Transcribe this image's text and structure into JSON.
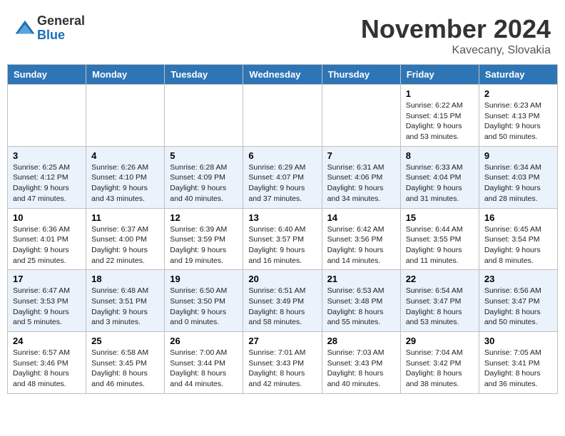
{
  "header": {
    "logo_line1": "General",
    "logo_line2": "Blue",
    "month_title": "November 2024",
    "subtitle": "Kavecany, Slovakia"
  },
  "weekdays": [
    "Sunday",
    "Monday",
    "Tuesday",
    "Wednesday",
    "Thursday",
    "Friday",
    "Saturday"
  ],
  "weeks": [
    [
      {
        "day": "",
        "info": ""
      },
      {
        "day": "",
        "info": ""
      },
      {
        "day": "",
        "info": ""
      },
      {
        "day": "",
        "info": ""
      },
      {
        "day": "",
        "info": ""
      },
      {
        "day": "1",
        "info": "Sunrise: 6:22 AM\nSunset: 4:15 PM\nDaylight: 9 hours and 53 minutes."
      },
      {
        "day": "2",
        "info": "Sunrise: 6:23 AM\nSunset: 4:13 PM\nDaylight: 9 hours and 50 minutes."
      }
    ],
    [
      {
        "day": "3",
        "info": "Sunrise: 6:25 AM\nSunset: 4:12 PM\nDaylight: 9 hours and 47 minutes."
      },
      {
        "day": "4",
        "info": "Sunrise: 6:26 AM\nSunset: 4:10 PM\nDaylight: 9 hours and 43 minutes."
      },
      {
        "day": "5",
        "info": "Sunrise: 6:28 AM\nSunset: 4:09 PM\nDaylight: 9 hours and 40 minutes."
      },
      {
        "day": "6",
        "info": "Sunrise: 6:29 AM\nSunset: 4:07 PM\nDaylight: 9 hours and 37 minutes."
      },
      {
        "day": "7",
        "info": "Sunrise: 6:31 AM\nSunset: 4:06 PM\nDaylight: 9 hours and 34 minutes."
      },
      {
        "day": "8",
        "info": "Sunrise: 6:33 AM\nSunset: 4:04 PM\nDaylight: 9 hours and 31 minutes."
      },
      {
        "day": "9",
        "info": "Sunrise: 6:34 AM\nSunset: 4:03 PM\nDaylight: 9 hours and 28 minutes."
      }
    ],
    [
      {
        "day": "10",
        "info": "Sunrise: 6:36 AM\nSunset: 4:01 PM\nDaylight: 9 hours and 25 minutes."
      },
      {
        "day": "11",
        "info": "Sunrise: 6:37 AM\nSunset: 4:00 PM\nDaylight: 9 hours and 22 minutes."
      },
      {
        "day": "12",
        "info": "Sunrise: 6:39 AM\nSunset: 3:59 PM\nDaylight: 9 hours and 19 minutes."
      },
      {
        "day": "13",
        "info": "Sunrise: 6:40 AM\nSunset: 3:57 PM\nDaylight: 9 hours and 16 minutes."
      },
      {
        "day": "14",
        "info": "Sunrise: 6:42 AM\nSunset: 3:56 PM\nDaylight: 9 hours and 14 minutes."
      },
      {
        "day": "15",
        "info": "Sunrise: 6:44 AM\nSunset: 3:55 PM\nDaylight: 9 hours and 11 minutes."
      },
      {
        "day": "16",
        "info": "Sunrise: 6:45 AM\nSunset: 3:54 PM\nDaylight: 9 hours and 8 minutes."
      }
    ],
    [
      {
        "day": "17",
        "info": "Sunrise: 6:47 AM\nSunset: 3:53 PM\nDaylight: 9 hours and 5 minutes."
      },
      {
        "day": "18",
        "info": "Sunrise: 6:48 AM\nSunset: 3:51 PM\nDaylight: 9 hours and 3 minutes."
      },
      {
        "day": "19",
        "info": "Sunrise: 6:50 AM\nSunset: 3:50 PM\nDaylight: 9 hours and 0 minutes."
      },
      {
        "day": "20",
        "info": "Sunrise: 6:51 AM\nSunset: 3:49 PM\nDaylight: 8 hours and 58 minutes."
      },
      {
        "day": "21",
        "info": "Sunrise: 6:53 AM\nSunset: 3:48 PM\nDaylight: 8 hours and 55 minutes."
      },
      {
        "day": "22",
        "info": "Sunrise: 6:54 AM\nSunset: 3:47 PM\nDaylight: 8 hours and 53 minutes."
      },
      {
        "day": "23",
        "info": "Sunrise: 6:56 AM\nSunset: 3:47 PM\nDaylight: 8 hours and 50 minutes."
      }
    ],
    [
      {
        "day": "24",
        "info": "Sunrise: 6:57 AM\nSunset: 3:46 PM\nDaylight: 8 hours and 48 minutes."
      },
      {
        "day": "25",
        "info": "Sunrise: 6:58 AM\nSunset: 3:45 PM\nDaylight: 8 hours and 46 minutes."
      },
      {
        "day": "26",
        "info": "Sunrise: 7:00 AM\nSunset: 3:44 PM\nDaylight: 8 hours and 44 minutes."
      },
      {
        "day": "27",
        "info": "Sunrise: 7:01 AM\nSunset: 3:43 PM\nDaylight: 8 hours and 42 minutes."
      },
      {
        "day": "28",
        "info": "Sunrise: 7:03 AM\nSunset: 3:43 PM\nDaylight: 8 hours and 40 minutes."
      },
      {
        "day": "29",
        "info": "Sunrise: 7:04 AM\nSunset: 3:42 PM\nDaylight: 8 hours and 38 minutes."
      },
      {
        "day": "30",
        "info": "Sunrise: 7:05 AM\nSunset: 3:41 PM\nDaylight: 8 hours and 36 minutes."
      }
    ]
  ]
}
